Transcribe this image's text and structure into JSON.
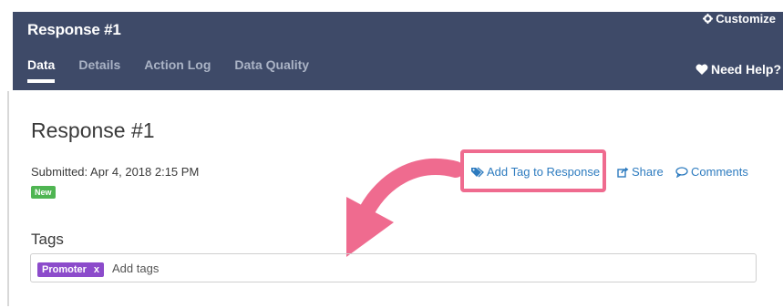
{
  "header": {
    "title": "Response #1",
    "customize_label": "Customize",
    "help_label": "Need Help?",
    "tabs": [
      {
        "label": "Data",
        "active": true
      },
      {
        "label": "Details"
      },
      {
        "label": "Action Log"
      },
      {
        "label": "Data Quality"
      }
    ]
  },
  "response": {
    "title": "Response #1",
    "submitted": "Submitted: Apr 4, 2018 2:15 PM",
    "badge": "New"
  },
  "actions": {
    "add_tag": "Add Tag to Response",
    "share": "Share",
    "comments": "Comments"
  },
  "tags": {
    "label": "Tags",
    "chip_label": "Promoter",
    "chip_remove": "x",
    "placeholder": "Add tags"
  },
  "colors": {
    "header_bg": "#3e4a68",
    "link": "#2d7bbf",
    "highlight": "#ef6b8f",
    "badge_new": "#4fb552",
    "tag_chip": "#8c4bcb"
  },
  "icons": [
    "gear-icon",
    "heart-icon",
    "tag-icon",
    "share-icon",
    "comment-icon",
    "annotation-arrow"
  ]
}
